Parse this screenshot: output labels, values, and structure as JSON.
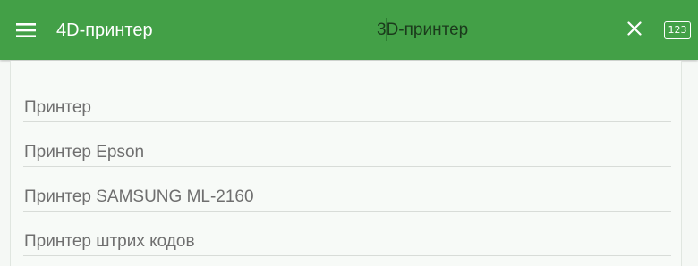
{
  "appbar": {
    "title": "4D-принтер",
    "search_value": "3D-принтер",
    "keyboard_toggle_label": "123",
    "menu_icon": "hamburger-menu-icon",
    "clear_icon": "close-icon",
    "accent_color": "#43a047"
  },
  "results": {
    "items": [
      {
        "label": "Принтер"
      },
      {
        "label": "Принтер Epson"
      },
      {
        "label": "Принтер SAMSUNG ML-2160"
      },
      {
        "label": "Принтер штрих кодов"
      }
    ]
  }
}
